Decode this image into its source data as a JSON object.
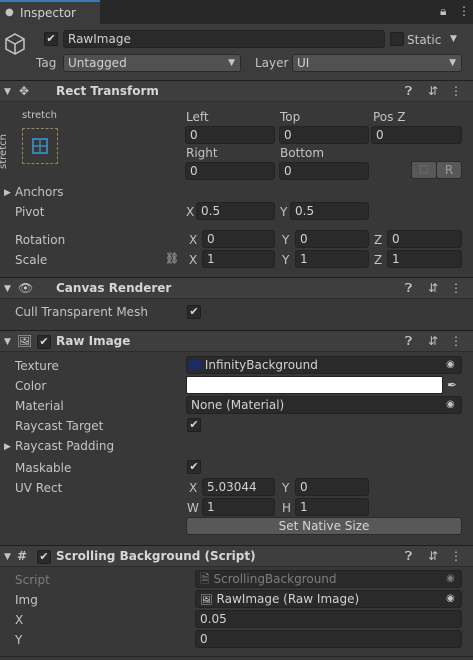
{
  "tab": {
    "title": "Inspector"
  },
  "object": {
    "name": "RawImage",
    "static_label": "Static",
    "tag_label": "Tag",
    "tag_value": "Untagged",
    "layer_label": "Layer",
    "layer_value": "UI"
  },
  "rect_transform": {
    "title": "Rect Transform",
    "anchor_preset_top": "stretch",
    "anchor_preset_side": "stretch",
    "left_label": "Left",
    "left_value": "0",
    "top_label": "Top",
    "top_value": "0",
    "posz_label": "Pos Z",
    "posz_value": "0",
    "right_label": "Right",
    "right_value": "0",
    "bottom_label": "Bottom",
    "bottom_value": "0",
    "r_button": "R",
    "anchors_label": "Anchors",
    "pivot_label": "Pivot",
    "pivot_x": "0.5",
    "pivot_y": "0.5",
    "rotation_label": "Rotation",
    "rot_x": "0",
    "rot_y": "0",
    "rot_z": "0",
    "scale_label": "Scale",
    "scale_x": "1",
    "scale_y": "1",
    "scale_z": "1",
    "x": "X",
    "y": "Y",
    "z": "Z"
  },
  "canvas_renderer": {
    "title": "Canvas Renderer",
    "cull_label": "Cull Transparent Mesh"
  },
  "raw_image": {
    "title": "Raw Image",
    "texture_label": "Texture",
    "texture_value": "InfinityBackground",
    "color_label": "Color",
    "color_value": "#ffffff",
    "material_label": "Material",
    "material_value": "None (Material)",
    "raycast_target_label": "Raycast Target",
    "raycast_padding_label": "Raycast Padding",
    "maskable_label": "Maskable",
    "uvrect_label": "UV Rect",
    "uv_x": "5.03044",
    "uv_y": "0",
    "uv_w": "1",
    "uv_h": "1",
    "x": "X",
    "y": "Y",
    "w": "W",
    "h": "H",
    "native_size_button": "Set Native Size"
  },
  "script": {
    "title": "Scrolling Background (Script)",
    "script_label": "Script",
    "script_value": "ScrollingBackground",
    "img_label": "Img",
    "img_value": "RawImage (Raw Image)",
    "x_label": "X",
    "x_value": "0.05",
    "y_label": "Y",
    "y_value": "0"
  },
  "colors": {
    "accent": "#3a79bb",
    "background": "#383838",
    "header": "#3e3e3e",
    "field": "#2a2a2a"
  }
}
